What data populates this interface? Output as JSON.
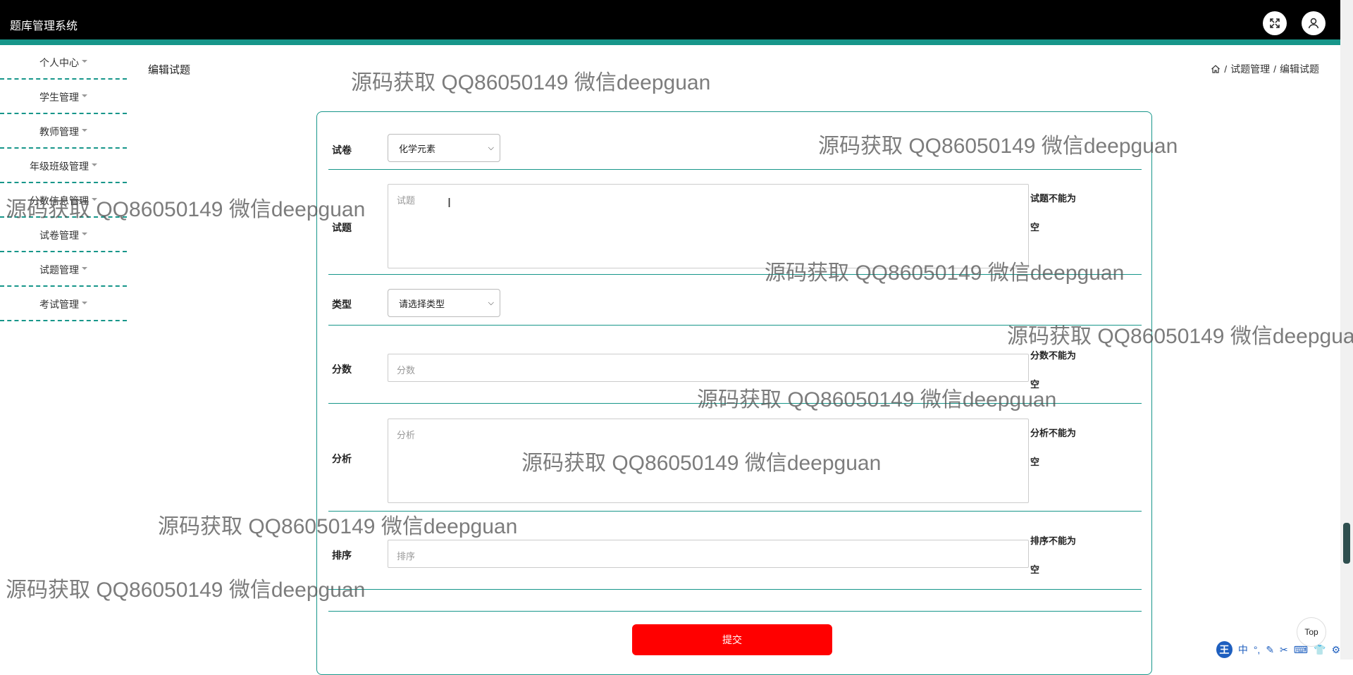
{
  "header": {
    "app_title": "题库管理系统",
    "expand_icon": "expand-icon",
    "user_icon": "user-icon"
  },
  "sidebar": {
    "items": [
      {
        "label": "个人中心"
      },
      {
        "label": "学生管理"
      },
      {
        "label": "教师管理"
      },
      {
        "label": "年级班级管理"
      },
      {
        "label": "分数信息管理"
      },
      {
        "label": "试卷管理"
      },
      {
        "label": "试题管理"
      },
      {
        "label": "考试管理"
      }
    ]
  },
  "page": {
    "title": "编辑试题",
    "breadcrumb": {
      "home_icon": "home-icon",
      "sep": "/",
      "level1": "试题管理",
      "level2": "编辑试题"
    }
  },
  "form": {
    "paper": {
      "label": "试卷",
      "value": "化学元素"
    },
    "question": {
      "label": "试题",
      "placeholder": "试题",
      "error_line1": "试题不能为",
      "error_line2": "空"
    },
    "type": {
      "label": "类型",
      "value": "请选择类型"
    },
    "score": {
      "label": "分数",
      "placeholder": "分数",
      "error_line1": "分数不能为",
      "error_line2": "空"
    },
    "analysis": {
      "label": "分析",
      "placeholder": "分析",
      "error_line1": "分析不能为",
      "error_line2": "空"
    },
    "order": {
      "label": "排序",
      "placeholder": "排序",
      "error_line1": "排序不能为",
      "error_line2": "空"
    },
    "submit_label": "提交"
  },
  "top_button": "Top",
  "watermark": "源码获取 QQ86050149 微信deepguan",
  "ime_toolbar": {
    "logo": "王",
    "mode": "中",
    "items": [
      "°,",
      "✎",
      "✂",
      "⌨",
      "👕",
      "⚙"
    ]
  },
  "colors": {
    "accent": "#17968a",
    "submit": "#ff0000",
    "topbar": "#000000"
  }
}
